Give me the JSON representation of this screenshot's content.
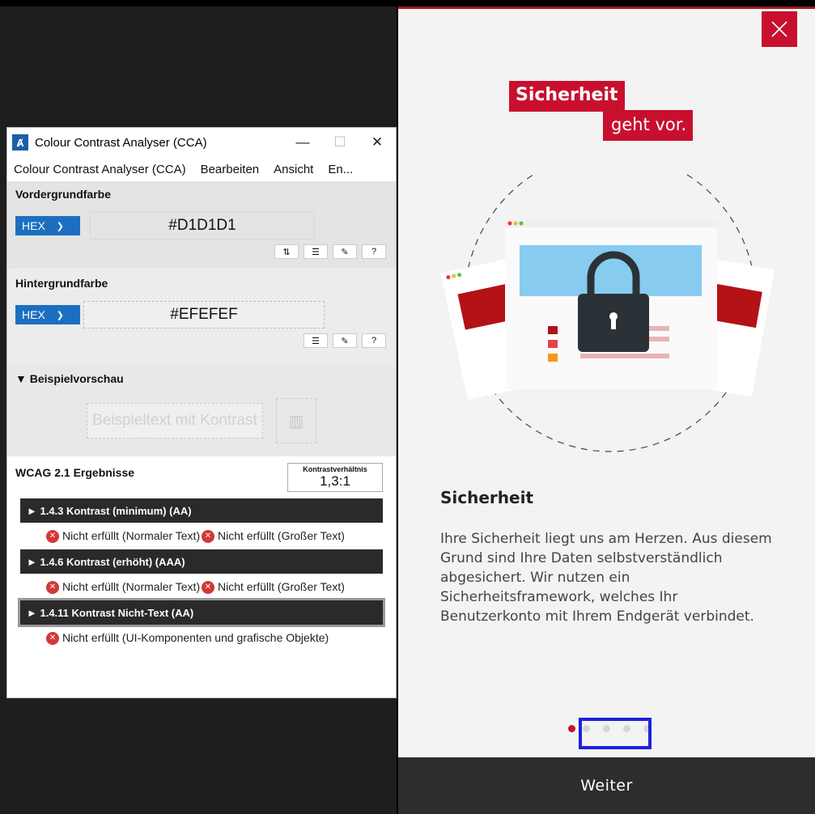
{
  "app": {
    "brand_line1": "Sicherheit",
    "brand_line2": "geht vor.",
    "title": "Sicherheit",
    "body": "Ihre Sicherheit liegt uns am Herzen. Aus diesem Grund sind Ihre Daten selbstverständlich abgesichert. Wir nutzen ein Sicherheitsframework, welches Ihr Benutzerkonto mit Ihrem Endgerät verbindet.",
    "cta": "Weiter",
    "pagination": {
      "total": 5,
      "active": 1
    },
    "colors": {
      "brand": "#c8102e",
      "bg": "#f3f3f3",
      "footer": "#2d2d2d"
    }
  },
  "cca": {
    "window_title": "Colour Contrast Analyser (CCA)",
    "menu": [
      "Colour Contrast Analyser (CCA)",
      "Bearbeiten",
      "Ansicht",
      "En..."
    ],
    "foreground": {
      "label": "Vordergrundfarbe",
      "format": "HEX",
      "value": "#D1D1D1"
    },
    "background": {
      "label": "Hintergrundfarbe",
      "format": "HEX",
      "value": "#EFEFEF"
    },
    "preview": {
      "label": "▼ Beispielvorschau",
      "text": "Beispieltext mit Kontrast"
    },
    "results": {
      "heading": "WCAG 2.1 Ergebnisse",
      "ratio_label": "Kontrastverhältnis",
      "ratio_value": "1,3:1",
      "criteria": [
        {
          "title": "► 1.4.3 Kontrast (minimum) (AA)",
          "r1": "Nicht erfüllt (Normaler Text)",
          "r2": "Nicht erfüllt (Großer Text)"
        },
        {
          "title": "► 1.4.6 Kontrast (erhöht) (AAA)",
          "r1": "Nicht erfüllt (Normaler Text)",
          "r2": "Nicht erfüllt (Großer Text)"
        },
        {
          "title": "► 1.4.11 Kontrast Nicht-Text (AA)",
          "r1": "Nicht erfüllt (UI-Komponenten und grafische Objekte)"
        }
      ]
    }
  }
}
